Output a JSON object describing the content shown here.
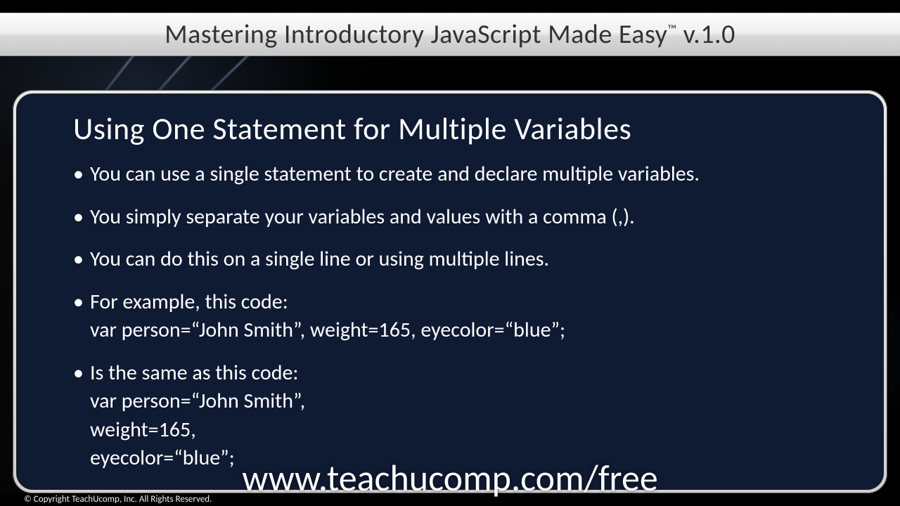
{
  "header": {
    "title_pre": "Mastering Introductory JavaScript Made Easy",
    "title_tm": "™",
    "title_post": " v.1.0"
  },
  "slide": {
    "heading": "Using One Statement for Multiple Variables",
    "bullets": [
      {
        "text": "You can use a single statement to create and declare multiple variables."
      },
      {
        "text": "You simply separate your variables and values with a comma (,)."
      },
      {
        "text": "You can do this on a single line or using multiple lines."
      },
      {
        "text": "For example, this code:",
        "code": [
          "var person=“John Smith”, weight=165, eyecolor=“blue”;"
        ]
      },
      {
        "text": "Is the same as this code:",
        "code": [
          "var person=“John Smith”,",
          "weight=165,",
          "eyecolor=“blue”;"
        ]
      }
    ]
  },
  "watermark": "www.teachucomp.com/free",
  "copyright": "© Copyright TeachUcomp, Inc. All Rights Reserved."
}
